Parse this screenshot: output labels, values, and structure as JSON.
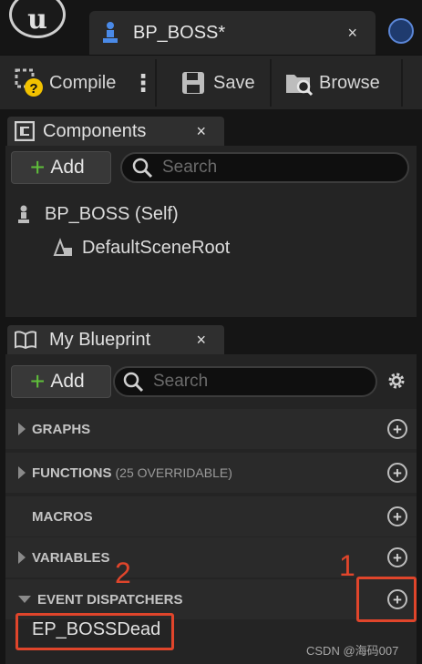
{
  "document_tab": {
    "title": "BP_BOSS*",
    "close": "×"
  },
  "toolbar": {
    "compile_label": "Compile",
    "more": "⋮",
    "save_label": "Save",
    "browse_label": "Browse"
  },
  "components_panel": {
    "tab_label": "Components",
    "close": "×",
    "add_label": "Add",
    "search_placeholder": "Search",
    "tree": [
      {
        "label": "BP_BOSS (Self)"
      },
      {
        "label": "DefaultSceneRoot"
      }
    ]
  },
  "my_blueprint_panel": {
    "tab_label": "My Blueprint",
    "close": "×",
    "add_label": "Add",
    "search_placeholder": "Search",
    "sections": [
      {
        "label": "GRAPHS",
        "sub": ""
      },
      {
        "label": "FUNCTIONS",
        "sub": "(25 OVERRIDABLE)"
      },
      {
        "label": "MACROS",
        "sub": ""
      },
      {
        "label": "VARIABLES",
        "sub": ""
      },
      {
        "label": "EVENT DISPATCHERS",
        "sub": ""
      }
    ],
    "dispatchers": [
      {
        "label": "EP_BOSSDead"
      }
    ]
  },
  "annotations": {
    "num1": "1",
    "num2": "2",
    "color": "#e0452b"
  },
  "watermark": "CSDN @海码007"
}
